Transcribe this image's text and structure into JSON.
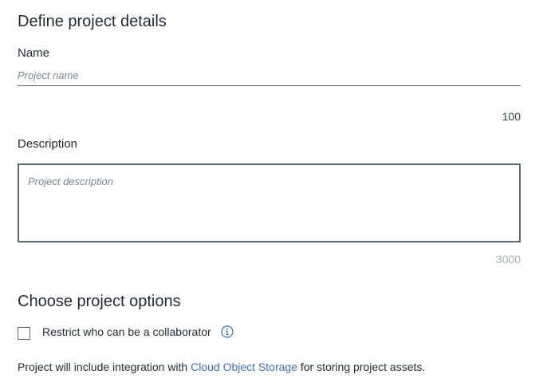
{
  "details": {
    "title": "Define project details",
    "name_label": "Name",
    "name_placeholder": "Project name",
    "name_counter": "100",
    "description_label": "Description",
    "description_placeholder": "Project description",
    "description_counter": "3000"
  },
  "options": {
    "title": "Choose project options",
    "restrict_label": "Restrict who can be a collaborator",
    "restrict_checked": false,
    "info_icon": "info-icon"
  },
  "storage_note": {
    "prefix": "Project will include integration with ",
    "link_text": "Cloud Object Storage",
    "suffix": " for storing project assets."
  },
  "colors": {
    "text": "#1f2a36",
    "link": "#3d70b2",
    "border": "#5a6872",
    "placeholder": "#7a8790",
    "counter_muted": "#a8b1b7"
  }
}
